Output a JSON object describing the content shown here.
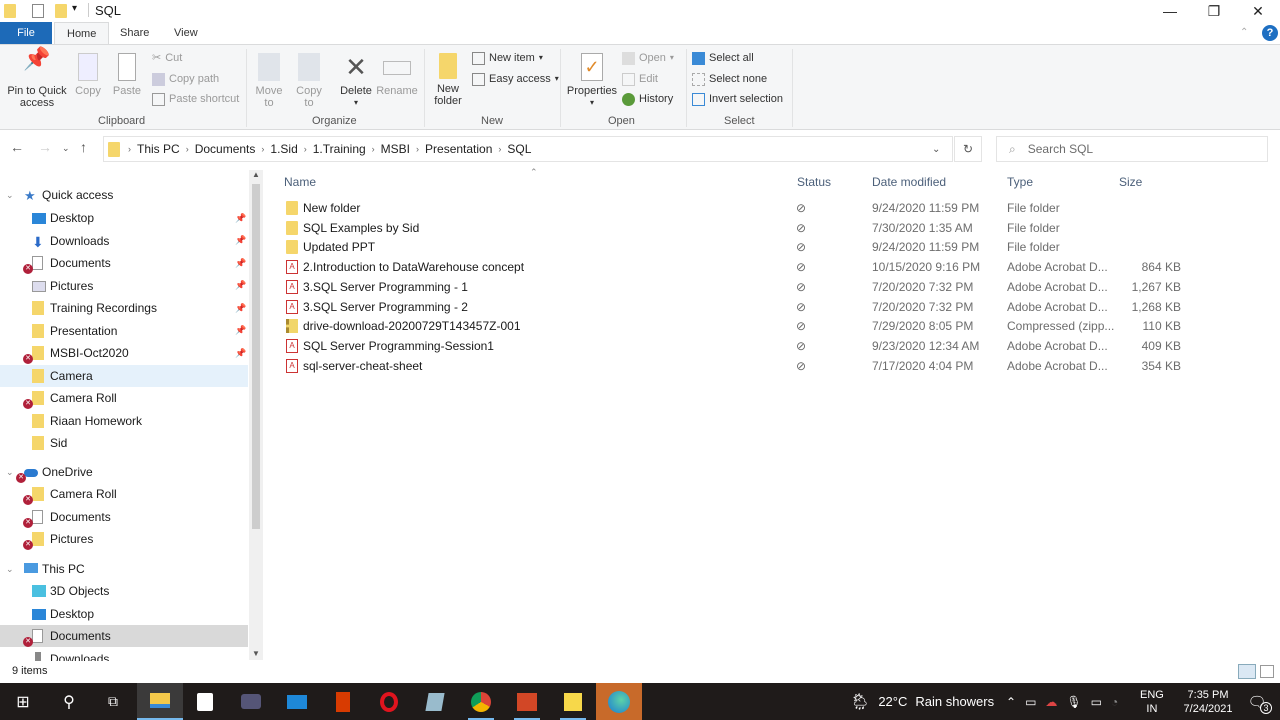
{
  "window": {
    "title": "SQL",
    "controls": {
      "minimize": "—",
      "restore": "❐",
      "close": "✕"
    }
  },
  "ribbon": {
    "tabs": [
      {
        "label": "File"
      },
      {
        "label": "Home"
      },
      {
        "label": "Share"
      },
      {
        "label": "View"
      }
    ],
    "groups": {
      "clipboard": {
        "label": "Clipboard",
        "pin": "Pin to Quick access",
        "copy": "Copy",
        "paste": "Paste",
        "cut": "Cut",
        "copy_path": "Copy path",
        "paste_shortcut": "Paste shortcut"
      },
      "organize": {
        "label": "Organize",
        "move_to": "Move to",
        "copy_to": "Copy to",
        "delete": "Delete",
        "rename": "Rename"
      },
      "new": {
        "label": "New",
        "new_folder": "New folder",
        "new_item": "New item",
        "easy_access": "Easy access"
      },
      "open": {
        "label": "Open",
        "properties": "Properties",
        "open": "Open",
        "edit": "Edit",
        "history": "History"
      },
      "select": {
        "label": "Select",
        "select_all": "Select all",
        "select_none": "Select none",
        "invert_selection": "Invert selection"
      }
    }
  },
  "address": {
    "breadcrumbs": [
      "This PC",
      "Documents",
      "1.Sid",
      "1.Training",
      "MSBI",
      "Presentation",
      "SQL"
    ],
    "search_placeholder": "Search SQL"
  },
  "nav": {
    "quick_access": {
      "label": "Quick access",
      "items": [
        {
          "label": "Desktop",
          "icon": "desktop-icon",
          "pinned": true,
          "error": false
        },
        {
          "label": "Downloads",
          "icon": "download-icon",
          "pinned": true,
          "error": false
        },
        {
          "label": "Documents",
          "icon": "documents-icon",
          "pinned": true,
          "error": true
        },
        {
          "label": "Pictures",
          "icon": "pictures-icon",
          "pinned": true,
          "error": false
        },
        {
          "label": "Training Recordings",
          "icon": "folder-icon",
          "pinned": true,
          "error": false
        },
        {
          "label": "Presentation",
          "icon": "folder-icon",
          "pinned": true,
          "error": false
        },
        {
          "label": "MSBI-Oct2020",
          "icon": "folder-icon",
          "pinned": true,
          "error": true
        },
        {
          "label": "Camera",
          "icon": "folder-icon",
          "pinned": false,
          "error": false
        },
        {
          "label": "Camera Roll",
          "icon": "folder-icon",
          "pinned": false,
          "error": true
        },
        {
          "label": "Riaan Homework",
          "icon": "folder-icon",
          "pinned": false,
          "error": false
        },
        {
          "label": "Sid",
          "icon": "folder-icon",
          "pinned": false,
          "error": false
        }
      ]
    },
    "onedrive": {
      "label": "OneDrive",
      "items": [
        {
          "label": "Camera Roll",
          "error": true
        },
        {
          "label": "Documents",
          "error": true
        },
        {
          "label": "Pictures",
          "error": true
        }
      ]
    },
    "this_pc": {
      "label": "This PC",
      "items": [
        {
          "label": "3D Objects"
        },
        {
          "label": "Desktop"
        },
        {
          "label": "Documents"
        },
        {
          "label": "Downloads"
        }
      ]
    }
  },
  "list": {
    "columns": {
      "name": "Name",
      "status": "Status",
      "date": "Date modified",
      "type": "Type",
      "size": "Size"
    },
    "rows": [
      {
        "name": "New folder",
        "kind": "folder",
        "status": "synced",
        "date": "9/24/2020 11:59 PM",
        "type": "File folder",
        "size": ""
      },
      {
        "name": "SQL Examples by Sid",
        "kind": "folder",
        "status": "synced",
        "date": "7/30/2020 1:35 AM",
        "type": "File folder",
        "size": ""
      },
      {
        "name": "Updated PPT",
        "kind": "folder",
        "status": "synced",
        "date": "9/24/2020 11:59 PM",
        "type": "File folder",
        "size": ""
      },
      {
        "name": "2.Introduction to DataWarehouse concept",
        "kind": "pdf",
        "status": "synced",
        "date": "10/15/2020 9:16 PM",
        "type": "Adobe Acrobat D...",
        "size": "864 KB"
      },
      {
        "name": "3.SQL Server Programming - 1",
        "kind": "pdf",
        "status": "synced",
        "date": "7/20/2020 7:32 PM",
        "type": "Adobe Acrobat D...",
        "size": "1,267 KB"
      },
      {
        "name": "3.SQL Server Programming - 2",
        "kind": "pdf",
        "status": "synced",
        "date": "7/20/2020 7:32 PM",
        "type": "Adobe Acrobat D...",
        "size": "1,268 KB"
      },
      {
        "name": "drive-download-20200729T143457Z-001",
        "kind": "zip",
        "status": "synced",
        "date": "7/29/2020 8:05 PM",
        "type": "Compressed (zipp...",
        "size": "110 KB"
      },
      {
        "name": "SQL Server Programming-Session1",
        "kind": "pdf",
        "status": "synced",
        "date": "9/23/2020 12:34 AM",
        "type": "Adobe Acrobat D...",
        "size": "409 KB"
      },
      {
        "name": "sql-server-cheat-sheet",
        "kind": "pdf",
        "status": "synced",
        "date": "7/17/2020 4:04 PM",
        "type": "Adobe Acrobat D...",
        "size": "354 KB"
      }
    ]
  },
  "status_bar": {
    "item_count": "9 items"
  },
  "taskbar": {
    "weather": {
      "temp": "22°C",
      "condition": "Rain showers"
    },
    "language": {
      "line1": "ENG",
      "line2": "IN"
    },
    "time": "7:35 PM",
    "date": "7/24/2021",
    "notifications": "3"
  }
}
